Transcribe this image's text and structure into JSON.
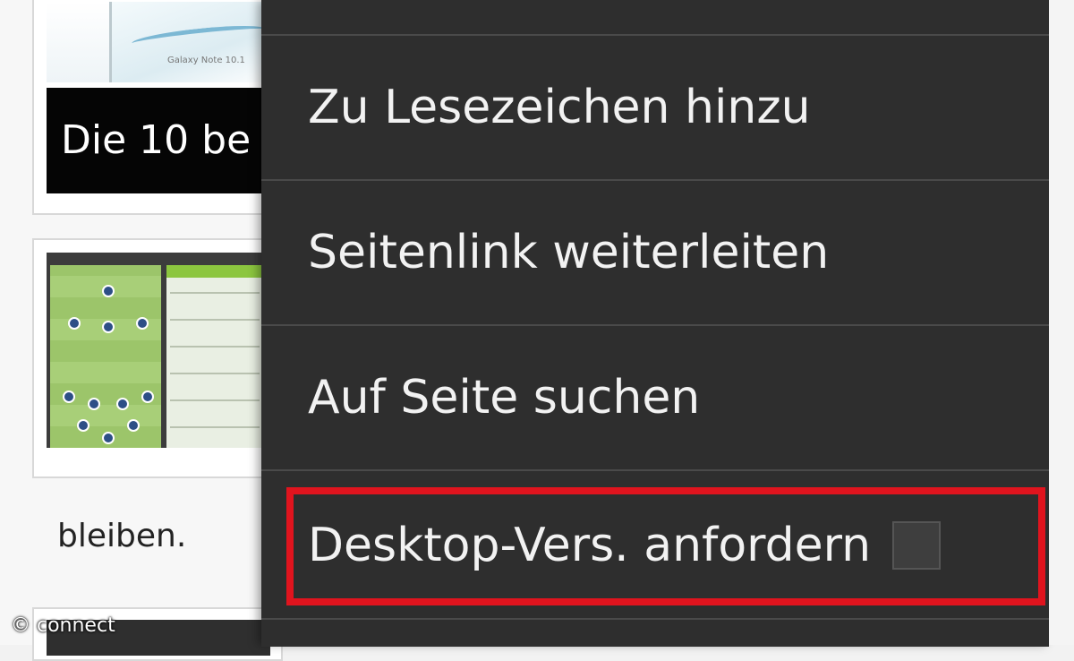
{
  "background_page": {
    "card1": {
      "headline": "Die 10 be",
      "caption": "Galaxy Note 10.1"
    },
    "card2": {
      "image_alt": "football-app-screenshots"
    },
    "text_fragment": "bleiben."
  },
  "menu": {
    "items": [
      {
        "label": "Zu Lesezeichen hinzu"
      },
      {
        "label": "Seitenlink weiterleiten"
      },
      {
        "label": "Auf Seite suchen"
      },
      {
        "label": "Desktop-Vers. anfordern",
        "checkbox_checked": false,
        "highlighted": true
      }
    ]
  },
  "watermark": "© connect",
  "colors": {
    "menu_background": "#2e2e2e",
    "menu_divider": "#4a4a4a",
    "highlight": "#e0141e"
  }
}
